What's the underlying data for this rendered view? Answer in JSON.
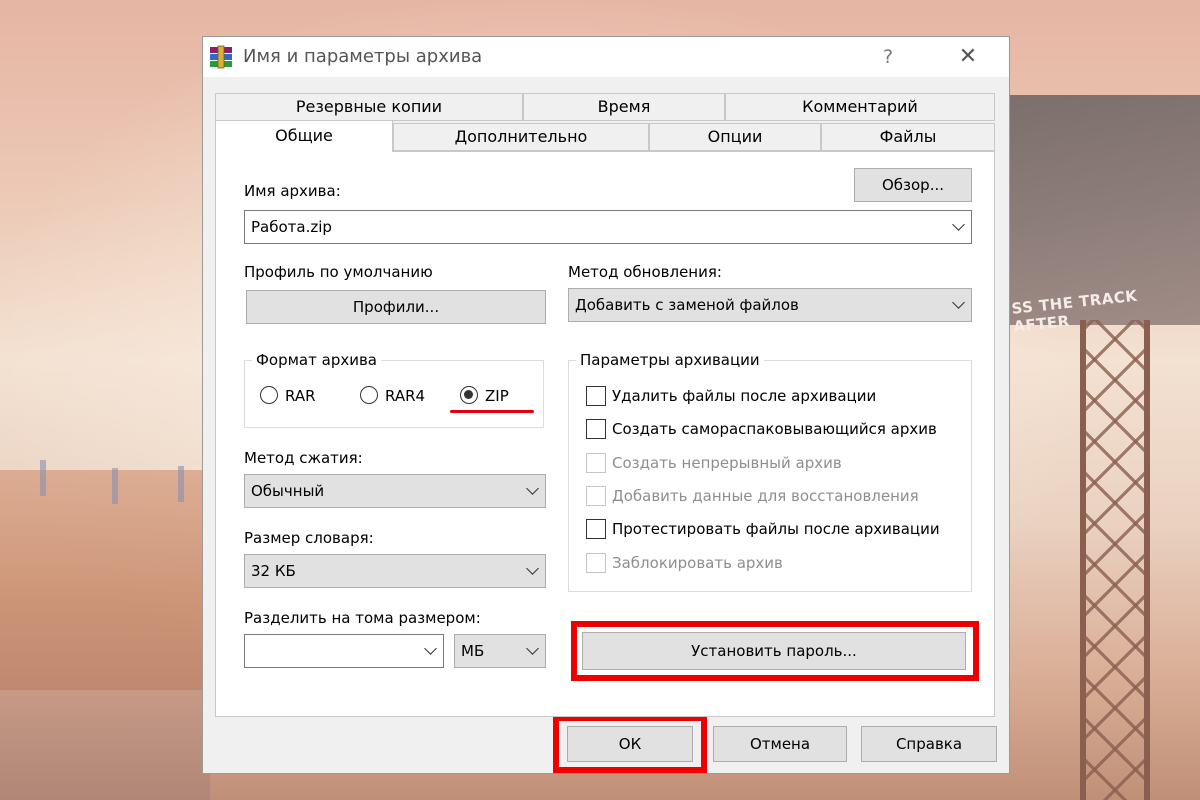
{
  "dialog": {
    "title": "Имя и параметры архива",
    "help": "?",
    "close": "✕"
  },
  "background": {
    "billboard_text": "SS THE TRACK AFTER"
  },
  "tabs": {
    "row1": [
      "Резервные копии",
      "Время",
      "Комментарий"
    ],
    "row2": [
      "Общие",
      "Дополнительно",
      "Опции",
      "Файлы"
    ],
    "active": "Общие"
  },
  "general": {
    "archive_name_label": "Имя архива:",
    "browse_button": "Обзор...",
    "archive_name_value": "Работа.zip",
    "default_profile_label": "Профиль по умолчанию",
    "profiles_button": "Профили...",
    "update_method_label": "Метод обновления:",
    "update_method_value": "Добавить с заменой файлов",
    "format": {
      "title": "Формат архива",
      "options": [
        "RAR",
        "RAR4",
        "ZIP"
      ],
      "selected": "ZIP"
    },
    "compression_label": "Метод сжатия:",
    "compression_value": "Обычный",
    "dictionary_label": "Размер словаря:",
    "dictionary_value": "32 КБ",
    "split_label": "Разделить на тома размером:",
    "split_value": "",
    "split_unit": "МБ",
    "options": {
      "title": "Параметры архивации",
      "items": [
        {
          "label": "Удалить файлы после архивации",
          "checked": false,
          "enabled": true
        },
        {
          "label": "Создать самораспаковывающийся архив",
          "checked": false,
          "enabled": true
        },
        {
          "label": "Создать непрерывный архив",
          "checked": false,
          "enabled": false
        },
        {
          "label": "Добавить данные для восстановления",
          "checked": false,
          "enabled": false
        },
        {
          "label": "Протестировать файлы после архивации",
          "checked": false,
          "enabled": true
        },
        {
          "label": "Заблокировать архив",
          "checked": false,
          "enabled": false
        }
      ]
    },
    "set_password_button": "Установить пароль..."
  },
  "footer": {
    "ok": "ОК",
    "cancel": "Отмена",
    "help": "Справка"
  },
  "colors": {
    "highlight": "#ee0000",
    "button_face": "#e1e1e1",
    "dialog_bg": "#f0f0f0"
  }
}
